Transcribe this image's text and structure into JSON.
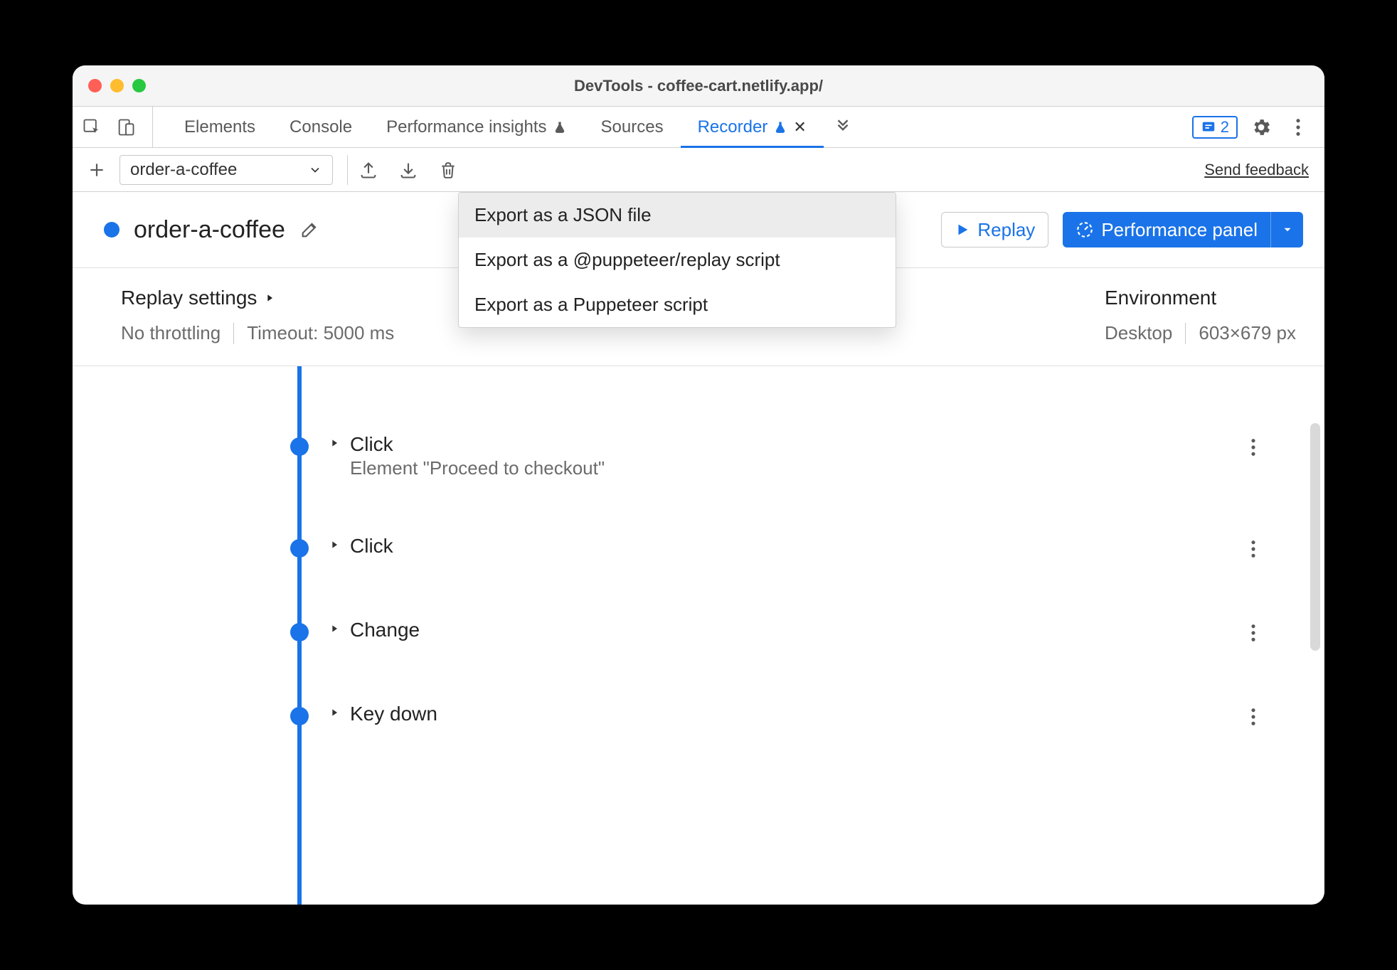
{
  "window": {
    "title": "DevTools - coffee-cart.netlify.app/"
  },
  "tabs": {
    "items": [
      "Elements",
      "Console",
      "Performance insights",
      "Sources",
      "Recorder"
    ],
    "active": "Recorder",
    "issues_count": "2"
  },
  "toolbar": {
    "recording_name": "order-a-coffee",
    "feedback_link": "Send feedback"
  },
  "export_menu": {
    "items": [
      "Export as a JSON file",
      "Export as a @puppeteer/replay script",
      "Export as a Puppeteer script"
    ]
  },
  "recording": {
    "title": "order-a-coffee",
    "replay_label": "Replay",
    "perf_label": "Performance panel"
  },
  "replay_settings": {
    "heading": "Replay settings",
    "throttling": "No throttling",
    "timeout": "Timeout: 5000 ms"
  },
  "environment": {
    "heading": "Environment",
    "device": "Desktop",
    "viewport": "603×679 px"
  },
  "steps": [
    {
      "title": "Click",
      "sub": "Element \"Proceed to checkout\""
    },
    {
      "title": "Click",
      "sub": ""
    },
    {
      "title": "Change",
      "sub": ""
    },
    {
      "title": "Key down",
      "sub": ""
    }
  ]
}
